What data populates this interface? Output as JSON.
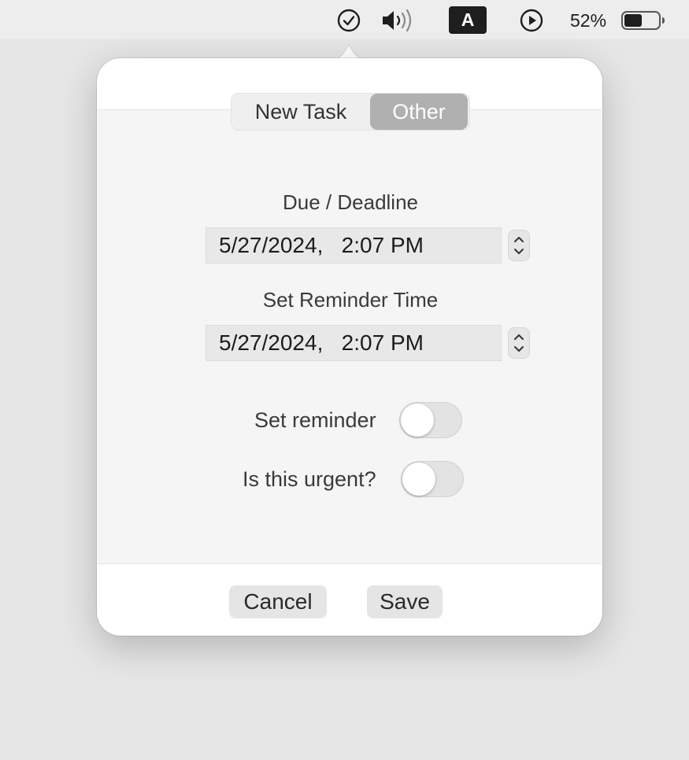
{
  "menubar": {
    "icons": [
      "checkmark-circle-icon",
      "speaker-volume-icon",
      "input-source-icon",
      "play-circle-icon",
      "battery-icon"
    ],
    "input_source_label": "A",
    "battery_percent": "52%",
    "battery_level": 0.52
  },
  "popover": {
    "tabs": [
      {
        "label": "New Task",
        "selected": false
      },
      {
        "label": "Other",
        "selected": true
      }
    ],
    "due_label": "Due / Deadline",
    "due_value": "5/27/2024,   2:07 PM",
    "reminder_time_label": "Set Reminder Time",
    "reminder_time_value": "5/27/2024,   2:07 PM",
    "set_reminder": {
      "label": "Set reminder",
      "on": false
    },
    "urgent": {
      "label": "Is this urgent?",
      "on": false
    },
    "cancel_label": "Cancel",
    "save_label": "Save"
  },
  "colors": {
    "selected_tab": "#b0b0b0",
    "menubar_bg": "#ededed",
    "panel_bg": "#f5f5f5"
  }
}
